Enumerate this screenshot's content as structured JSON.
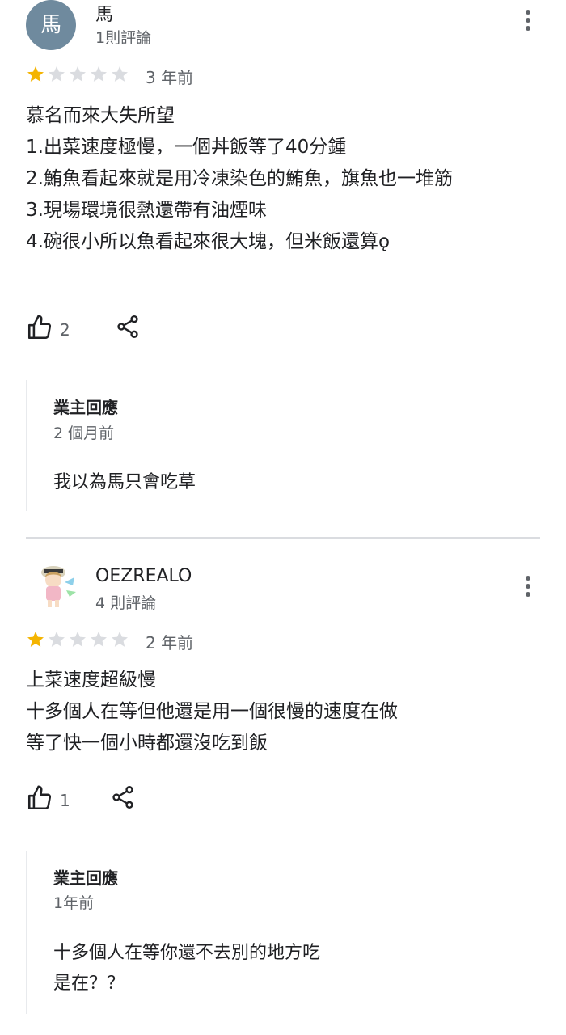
{
  "reviews": [
    {
      "avatar_letter": "馬",
      "name": "馬",
      "review_count": "1則評論",
      "rating": 1,
      "date": "3 年前",
      "text": "慕名而來大失所望\n1.出菜速度極慢，一個丼飯等了40分鍾\n2.鮪魚看起來就是用冷凍染色的鮪魚，旗魚也一堆筋\n3.現場環境很熱還帶有油煙味\n4.碗很小所以魚看起來很大塊，但米飯還算ǫ",
      "likes": "2",
      "reply": {
        "title": "業主回應",
        "date": "2 個月前",
        "text": "我以為馬只會吃草"
      }
    },
    {
      "name": "OEZREALO",
      "review_count": "4 則評論",
      "rating": 1,
      "date": "2 年前",
      "text": "上菜速度超級慢\n十多個人在等但他還是用一個很慢的速度在做\n等了快一個小時都還沒吃到飯",
      "likes": "1",
      "reply": {
        "title": "業主回應",
        "date": "1年前",
        "text": "十多個人在等你還不去別的地方吃\n是在？？"
      }
    }
  ],
  "colors": {
    "star_filled": "#f4b400",
    "star_empty": "#dadce0",
    "icon": "#202124",
    "avatar_bg": "#6f8a9e"
  },
  "icons": {
    "like": "thumb-up-icon",
    "share": "share-icon",
    "more": "more-vert-icon"
  }
}
